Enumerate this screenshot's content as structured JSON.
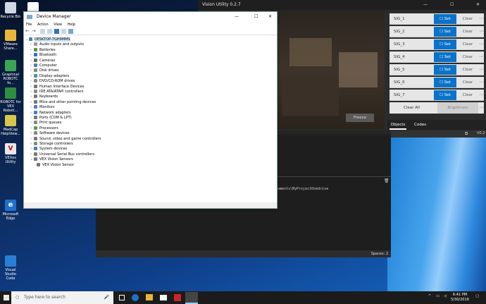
{
  "desktop": {
    "icons": [
      {
        "label": "Recycle Bin",
        "icon": "recycle-bin-icon"
      },
      {
        "label": "",
        "icon": "document-icon"
      },
      {
        "label": "VMware Share...",
        "icon": "folder-icon"
      },
      {
        "label": "Graphical ROBOTC fo...",
        "icon": "robotc-graphical-icon"
      },
      {
        "label": "ROBOTC for VEX Roboti...",
        "icon": "robotc-icon"
      },
      {
        "label": "MadCap HelpView...",
        "icon": "help-icon"
      },
      {
        "label": "VEXos Utility",
        "icon": "vex-icon"
      },
      {
        "label": "Microsoft Edge",
        "icon": "edge-icon"
      },
      {
        "label": "Visual Studio Code",
        "icon": "vscode-icon"
      }
    ]
  },
  "vision_utility": {
    "title": "Vision Utility 0.2.7",
    "freeze_label": "Freeze",
    "signatures": [
      {
        "name": "SIG_1"
      },
      {
        "name": "SIG_2"
      },
      {
        "name": "SIG_3"
      },
      {
        "name": "SIG_4"
      },
      {
        "name": "SIG_5"
      },
      {
        "name": "SIG_6"
      },
      {
        "name": "SIG_7"
      }
    ],
    "set_label": "Set",
    "clear_label": "Clear",
    "clear_all_label": "Clear All",
    "brightness_label": "Brightness",
    "tabs": [
      "Objects",
      "Codes"
    ],
    "version_short": "V0.2"
  },
  "editor": {
    "path_text": "ocuments\\MyProjectOnedrive",
    "status_spaces": "Spaces: 2"
  },
  "device_manager": {
    "title": "Device Manager",
    "menu": [
      "File",
      "Action",
      "View",
      "Help"
    ],
    "root": "DESKTOP-7GH9MMS",
    "items": [
      "Audio inputs and outputs",
      "Batteries",
      "Bluetooth",
      "Cameras",
      "Computer",
      "Disk drives",
      "Display adapters",
      "DVD/CD-ROM drives",
      "Human Interface Devices",
      "IDE ATA/ATAPI controllers",
      "Keyboards",
      "Mice and other pointing devices",
      "Monitors",
      "Network adapters",
      "Ports (COM & LPT)",
      "Print queues",
      "Processors",
      "Software devices",
      "Sound, video and game controllers",
      "Storage controllers",
      "System devices",
      "Universal Serial Bus controllers",
      "VEX Vision Sensors"
    ],
    "child": "VEX Vision Sensor"
  },
  "taskbar": {
    "search_placeholder": "Type here to search",
    "time": "6:41 PM",
    "date": "5/30/2019"
  }
}
